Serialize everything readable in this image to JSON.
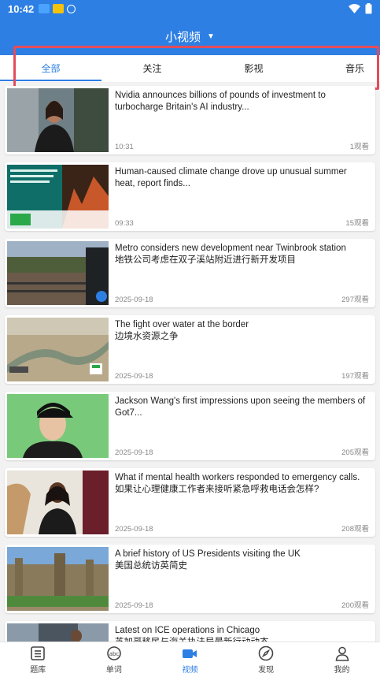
{
  "status_bar": {
    "time": "10:42"
  },
  "header": {
    "title": "小视频"
  },
  "tabs": [
    {
      "label": "全部",
      "active": true
    },
    {
      "label": "关注",
      "active": false
    },
    {
      "label": "影视",
      "active": false
    },
    {
      "label": "音乐",
      "active": false
    }
  ],
  "feed": [
    {
      "title": "Nvidia announces billions of pounds of investment to turbocharge Britain's AI industry...",
      "date": "10:31",
      "views": "1观看"
    },
    {
      "title": "Human-caused climate change drove up unusual summer heat, report finds...",
      "date": "09:33",
      "views": "15观看"
    },
    {
      "title": "Metro considers new development near Twinbrook station\n地铁公司考虑在双子溪站附近进行新开发项目",
      "date": "2025-09-18",
      "views": "297观看"
    },
    {
      "title": "The fight over water at the border\n边境水资源之争",
      "date": "2025-09-18",
      "views": "197观看"
    },
    {
      "title": "Jackson Wang's first impressions upon seeing the members of Got7...",
      "date": "2025-09-18",
      "views": "205观看"
    },
    {
      "title": "What if mental health workers responded to emergency calls.\n如果让心理健康工作者来接听紧急呼救电话会怎样?",
      "date": "2025-09-18",
      "views": "208观看"
    },
    {
      "title": "A brief history of US Presidents visiting the UK\n美国总统访英简史",
      "date": "2025-09-18",
      "views": "200观看"
    },
    {
      "title": "Latest on ICE operations in Chicago\n芝加哥移民与海关执法局最新行动动态",
      "date": "",
      "views": ""
    }
  ],
  "bottom_nav": [
    {
      "label": "题库",
      "icon": "list-icon",
      "active": false
    },
    {
      "label": "单词",
      "icon": "abc-icon",
      "active": false
    },
    {
      "label": "视频",
      "icon": "video-camera-icon",
      "active": true
    },
    {
      "label": "发现",
      "icon": "compass-icon",
      "active": false
    },
    {
      "label": "我的",
      "icon": "person-icon",
      "active": false
    }
  ],
  "colors": {
    "primary": "#2d7fe3",
    "highlight": "#e34c5b"
  }
}
